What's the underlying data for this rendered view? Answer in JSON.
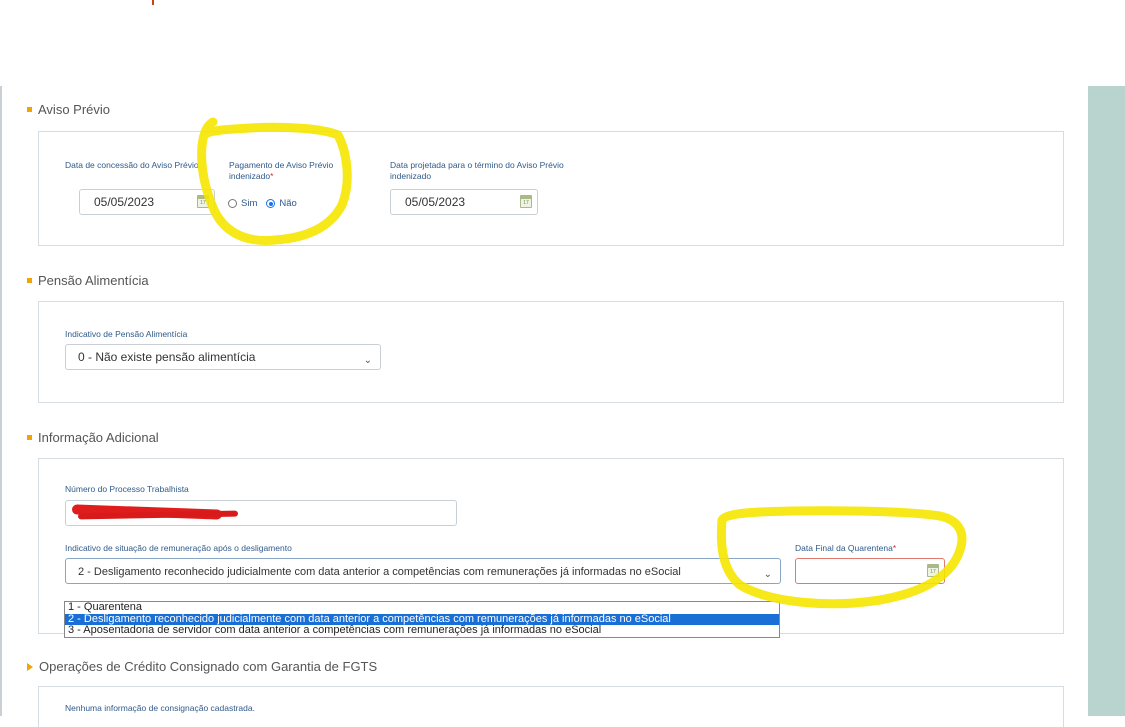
{
  "aviso_previo": {
    "section_title": "Aviso Prévio",
    "concessao_label": "Data de concessão do Aviso Prévio",
    "concessao_value": "05/05/2023",
    "pagamento_label": "Pagamento de Aviso Prévio indenizado",
    "required_mark": "*",
    "radio_sim": "Sim",
    "radio_nao": "Não",
    "radio_selected": "Não",
    "termino_label": "Data projetada para o término do Aviso Prévio indenizado",
    "termino_value": "05/05/2023",
    "calendar_icon_text": "17"
  },
  "pensao": {
    "section_title": "Pensão Alimentícia",
    "indicativo_label": "Indicativo de Pensão Alimentícia",
    "indicativo_value": "0 - Não existe pensão alimentícia"
  },
  "informacao": {
    "section_title": "Informação Adicional",
    "processo_label": "Número do Processo Trabalhista",
    "situacao_label": "Indicativo de situação de remuneração após o desligamento",
    "situacao_value": "2 - Desligamento reconhecido judicialmente com data anterior a competências com remunerações já informadas no eSocial",
    "data_final_label": "Data Final da Quarentena",
    "data_final_value": "",
    "required_mark": "*",
    "options": [
      "1 - Quarentena",
      "2 - Desligamento reconhecido judicialmente com data anterior a competências com remunerações já informadas no eSocial",
      "3 - Aposentadoria de servidor com data anterior a competências com remunerações já informadas no eSocial"
    ],
    "selected_option_index": 1
  },
  "credito": {
    "section_title": "Operações de Crédito Consignado com Garantia de FGTS",
    "empty_text": "Nenhuma informação de consignação cadastrada."
  },
  "colors": {
    "accent": "#f0a500",
    "label": "#2f5a8a",
    "selected_option": "#1a6fd6",
    "highlight": "#f5e600",
    "side_panel": "#b9d3cf"
  }
}
